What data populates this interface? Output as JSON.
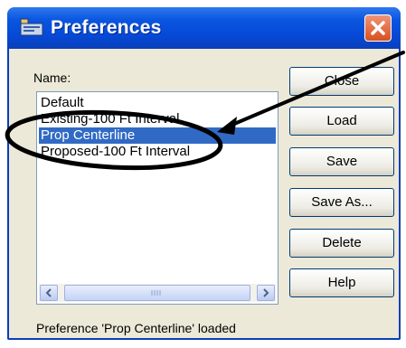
{
  "window": {
    "title": "Preferences",
    "title_icon": "preferences-app-icon",
    "close_icon": "close-icon"
  },
  "name_label": "Name:",
  "preferences_list": {
    "items": [
      {
        "label": "Default",
        "selected": false
      },
      {
        "label": "Existing-100 Ft Interval",
        "selected": false
      },
      {
        "label": "Prop Centerline",
        "selected": true
      },
      {
        "label": "Proposed-100 Ft Interval",
        "selected": false
      }
    ]
  },
  "buttons": {
    "close": "Close",
    "load": "Load",
    "save": "Save",
    "save_as": "Save As...",
    "delete": "Delete",
    "help": "Help"
  },
  "status_text": "Preference 'Prop Centerline' loaded",
  "colors": {
    "titlebar": "#0549d6",
    "selection": "#316ac5",
    "close_button": "#d8501e",
    "annotation": "#000000"
  }
}
